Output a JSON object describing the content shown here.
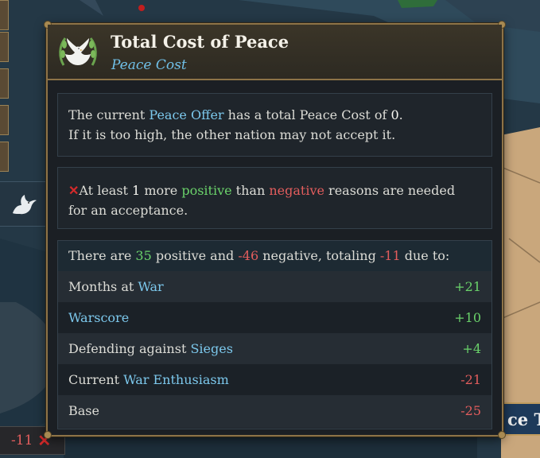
{
  "tooltip": {
    "title": "Total Cost of Peace",
    "subtitle": "Peace Cost",
    "intro": {
      "p1": "The current ",
      "peace_offer": "Peace Offer",
      "p2": " has a total Peace Cost of ",
      "cost": "0",
      "p3": ".",
      "line2": "If it is too high, the other nation may not accept it."
    },
    "requirement": {
      "icon": "cross-icon",
      "p1": "At least ",
      "count": "1",
      "p2": " more ",
      "positive": "positive",
      "p3": " than ",
      "negative": "negative",
      "p4": " reasons are needed",
      "line2": "for an acceptance."
    },
    "summary": {
      "p1": "There are ",
      "positive": "35",
      "p2": " positive and ",
      "negative": "-46",
      "p3": " negative, totaling ",
      "total": "-11",
      "p4": " due to:"
    },
    "reasons": [
      {
        "prefix": "Months at ",
        "link": "War",
        "value": "+21",
        "sign": "positive"
      },
      {
        "prefix": "",
        "link": "Warscore",
        "value": "+10",
        "sign": "positive"
      },
      {
        "prefix": "Defending against ",
        "link": "Sieges",
        "value": "+4",
        "sign": "positive"
      },
      {
        "prefix": "Current ",
        "link": "War Enthusiasm",
        "value": "-21",
        "sign": "negative"
      },
      {
        "prefix": "Base",
        "link": "",
        "value": "-25",
        "sign": "negative"
      }
    ]
  },
  "background": {
    "bottom_badge_value": "-11",
    "bottom_badge_icon": "cross-icon",
    "right_button_text": "ce Tr",
    "dove_icon": "dove-icon"
  },
  "colors": {
    "accent_blue": "#7cc8ec",
    "positive_green": "#6ad26a",
    "negative_red": "#e35d5d",
    "border_gold": "#8d7347"
  }
}
